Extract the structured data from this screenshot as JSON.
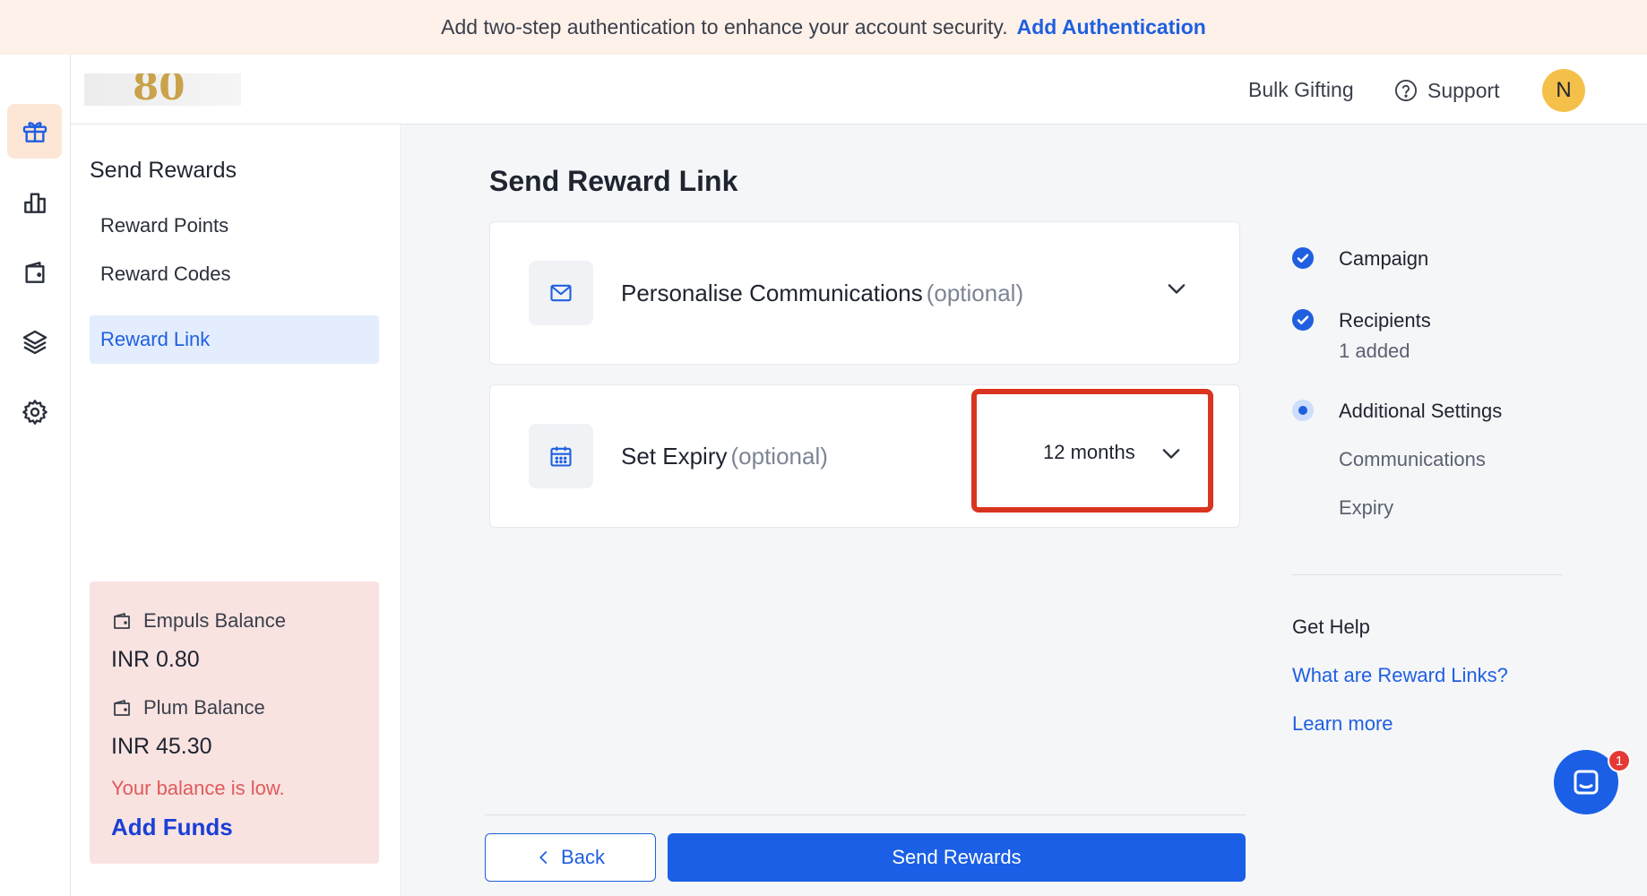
{
  "banner": {
    "text": "Add two-step authentication to enhance your account security.",
    "link": "Add Authentication"
  },
  "rail": {
    "items": [
      {
        "icon": "gift-icon",
        "active": true
      },
      {
        "icon": "bar-chart-icon",
        "active": false
      },
      {
        "icon": "wallet-icon",
        "active": false
      },
      {
        "icon": "layers-icon",
        "active": false
      },
      {
        "icon": "gear-icon",
        "active": false
      }
    ]
  },
  "header": {
    "bulk_gifting": "Bulk Gifting",
    "support": "Support",
    "avatar_initial": "N"
  },
  "subnav": {
    "title": "Send Rewards",
    "items": [
      {
        "label": "Reward Points"
      },
      {
        "label": "Reward Codes"
      },
      {
        "label": "Reward Link"
      }
    ]
  },
  "balance": {
    "empuls_label": "Empuls Balance",
    "empuls_value": "INR 0.80",
    "plum_label": "Plum Balance",
    "plum_value": "INR 45.30",
    "low_text": "Your balance is low.",
    "add_funds": "Add Funds"
  },
  "main": {
    "title": "Send Reward Link",
    "personalise": {
      "title": "Personalise Communications",
      "optional": "(optional)"
    },
    "expiry": {
      "title": "Set Expiry",
      "optional": "(optional)",
      "value": "12 months"
    },
    "back": "Back",
    "send": "Send Rewards"
  },
  "steps": {
    "campaign": "Campaign",
    "recipients": "Recipients",
    "recipients_sub": "1 added",
    "additional": "Additional Settings",
    "communications": "Communications",
    "expiry": "Expiry"
  },
  "help": {
    "title": "Get Help",
    "link1": "What are Reward Links?",
    "link2": "Learn more"
  },
  "chat": {
    "badge": "1"
  },
  "colors": {
    "accent": "#1a5fe6",
    "highlight": "#d9341f",
    "banner_bg": "#fdf1ea",
    "balance_bg": "#f8e3e1"
  }
}
